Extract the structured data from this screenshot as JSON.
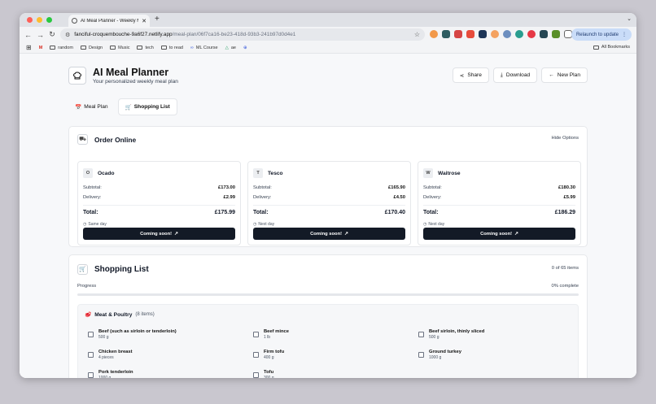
{
  "browser": {
    "tab_title": "AI Meal Planner - Weekly Me",
    "url_host": "fanciful-croquembouche-9a6f27.netlify.app",
    "url_path": "/meal-plan/06f7ca16-be23-418d-93b3-241b97d0d4e1",
    "relaunch_label": "Relaunch to update",
    "bookmarks": [
      "random",
      "Design",
      "Music",
      "tech",
      "to read",
      "ML Course",
      "ae"
    ],
    "all_bookmarks": "All Bookmarks"
  },
  "app": {
    "title": "AI Meal Planner",
    "subtitle": "Your personalized weekly meal plan",
    "actions": {
      "share": "Share",
      "download": "Download",
      "new_plan": "New Plan"
    },
    "tabs": {
      "meal_plan": "Meal Plan",
      "shopping_list": "Shopping List"
    }
  },
  "order": {
    "title": "Order Online",
    "hide_options": "Hide Options",
    "subtotal_label": "Subtotal:",
    "delivery_label": "Delivery:",
    "total_label": "Total:",
    "button_label": "Coming soon!",
    "stores": [
      {
        "initial": "O",
        "name": "Ocado",
        "subtotal": "£173.00",
        "delivery": "£2.99",
        "total": "£175.99",
        "eta": "Same day"
      },
      {
        "initial": "T",
        "name": "Tesco",
        "subtotal": "£165.90",
        "delivery": "£4.50",
        "total": "£170.40",
        "eta": "Next day"
      },
      {
        "initial": "W",
        "name": "Waitrose",
        "subtotal": "£180.30",
        "delivery": "£5.99",
        "total": "£186.29",
        "eta": "Next day"
      }
    ]
  },
  "shopping": {
    "title": "Shopping List",
    "count": "0 of 65 items",
    "progress_label": "Progress",
    "progress_text": "0% complete",
    "progress_fraction": 0,
    "category": {
      "name": "Meat & Poultry",
      "count": "(8 items)",
      "items": [
        {
          "name": "Beef (such as sirloin or tenderloin)",
          "qty": "500 g"
        },
        {
          "name": "Beef mince",
          "qty": "1 lb"
        },
        {
          "name": "Beef sirloin, thinly sliced",
          "qty": "500 g"
        },
        {
          "name": "Chicken breast",
          "qty": "4 pieces"
        },
        {
          "name": "Firm tofu",
          "qty": "400 g"
        },
        {
          "name": "Ground turkey",
          "qty": "1000 g"
        },
        {
          "name": "Pork tenderloin",
          "qty": "1000 g"
        },
        {
          "name": "Tofu",
          "qty": "300 g"
        }
      ]
    }
  }
}
